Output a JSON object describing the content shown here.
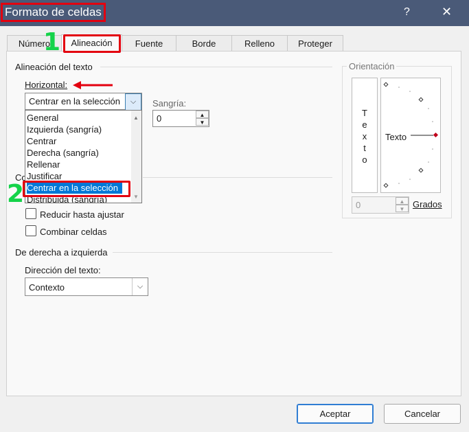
{
  "window": {
    "title": "Formato de celdas",
    "help_label": "?",
    "close_label": "✕"
  },
  "tabs": [
    {
      "label": "Número"
    },
    {
      "label": "Alineación"
    },
    {
      "label": "Fuente"
    },
    {
      "label": "Borde"
    },
    {
      "label": "Relleno"
    },
    {
      "label": "Proteger"
    }
  ],
  "text_alignment": {
    "group_title": "Alineación del texto",
    "horizontal_label": "Horizontal:",
    "horizontal_value": "Centrar en la selección",
    "indent_label": "Sangría:",
    "indent_value": "0",
    "options": [
      "General",
      "Izquierda (sangría)",
      "Centrar",
      "Derecha (sangría)",
      "Rellenar",
      "Justificar",
      "Centrar en la selección",
      "Distribuida (sangría)"
    ],
    "selected_index": 6,
    "control_group_initial": "Co"
  },
  "text_control": {
    "shrink_label": "Reducir hasta ajustar",
    "merge_label": "Combinar celdas"
  },
  "rtl": {
    "group_title": "De derecha a izquierda",
    "direction_label": "Dirección del texto:",
    "direction_value": "Contexto"
  },
  "orientation": {
    "group_title": "Orientación",
    "vertical_text": [
      "T",
      "e",
      "x",
      "t",
      "o"
    ],
    "dial_text": "Texto",
    "degrees_value": "0",
    "degrees_label": "Grados"
  },
  "buttons": {
    "ok": "Aceptar",
    "cancel": "Cancelar"
  },
  "annotations": {
    "step1": "1",
    "step2": "2"
  },
  "colors": {
    "highlight": "#e3000f",
    "annotation_green": "#15d34a",
    "selection": "#0078d7",
    "titlebar": "#4a5a78"
  }
}
